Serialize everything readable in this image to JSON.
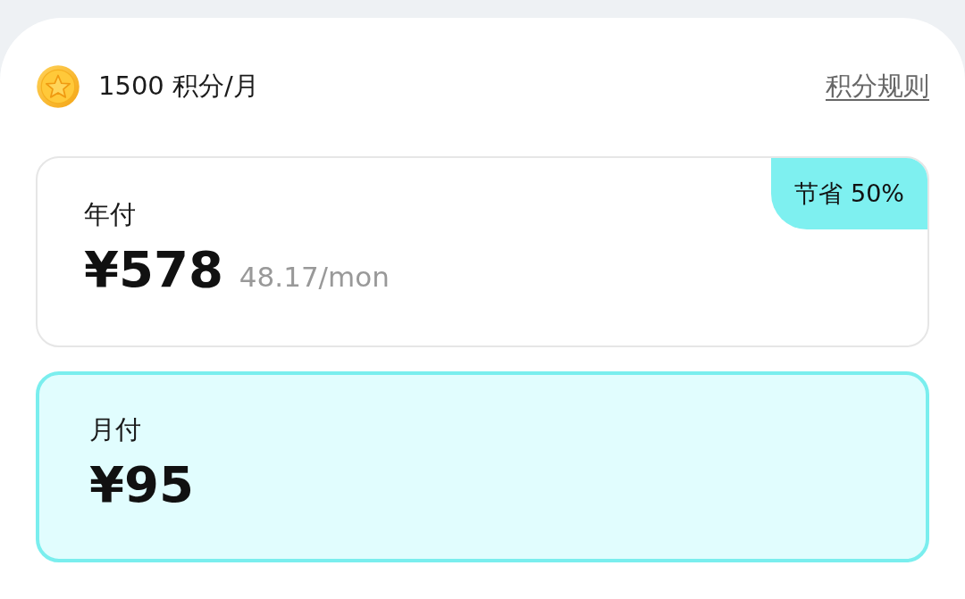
{
  "header": {
    "points": "1500 积分/月",
    "rules_link": "积分规则"
  },
  "plans": [
    {
      "label": "年付",
      "price": "¥578",
      "per_month": "48.17/mon",
      "badge": "节省 50%",
      "selected": false
    },
    {
      "label": "月付",
      "price": "¥95",
      "selected": true
    }
  ]
}
